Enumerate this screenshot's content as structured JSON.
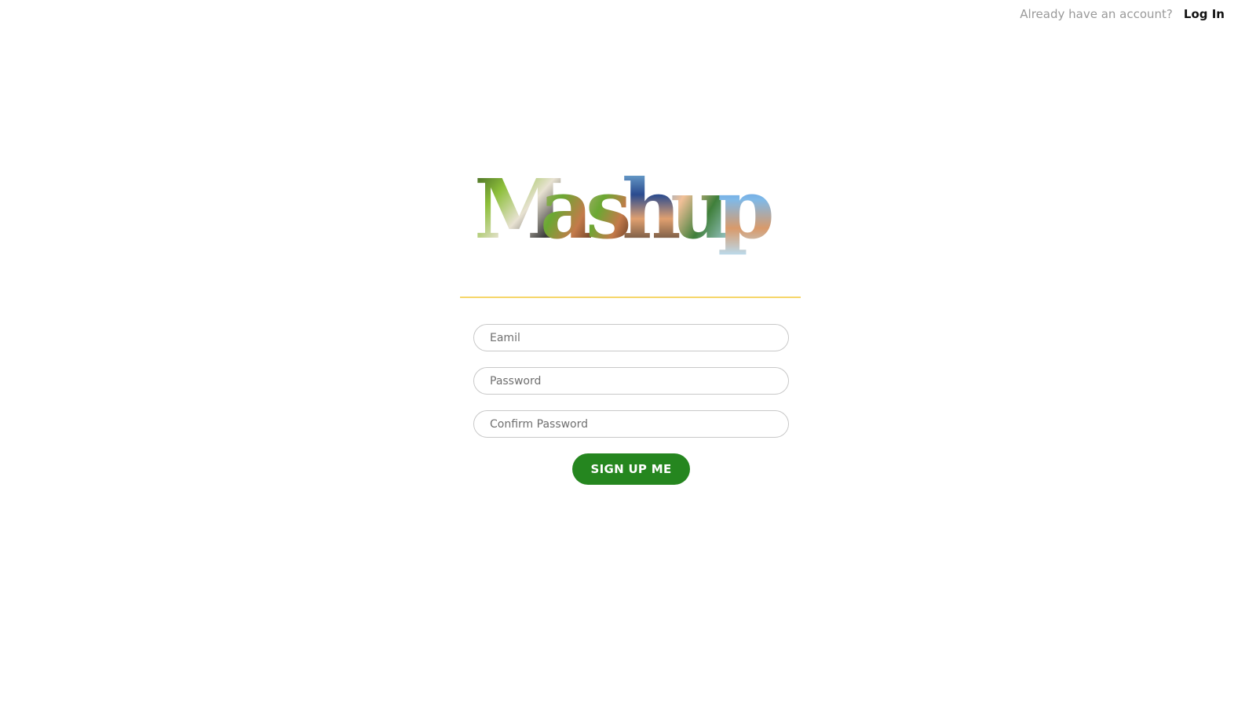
{
  "header": {
    "account_prompt": "Already have an account?",
    "login_label": "Log In"
  },
  "logo": {
    "text": "Mashup"
  },
  "form": {
    "email_placeholder": "Eamil",
    "password_placeholder": "Password",
    "confirm_password_placeholder": "Confirm Password",
    "submit_label": "SIGN UP ME"
  },
  "colors": {
    "accent_line": "#f6d66a",
    "button": "#25861f"
  }
}
